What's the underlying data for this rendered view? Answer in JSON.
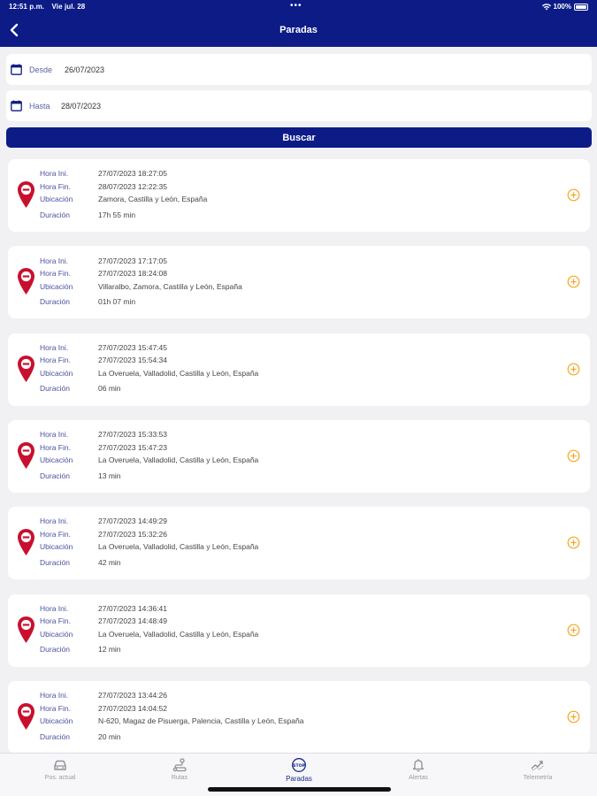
{
  "status_bar": {
    "time": "12:51 p.m.",
    "date": "Vie jul. 28",
    "battery": "100%"
  },
  "header": {
    "title": "Paradas"
  },
  "filters": {
    "desde": {
      "label": "Desde",
      "value": "26/07/2023"
    },
    "hasta": {
      "label": "Hasta",
      "value": "28/07/2023"
    },
    "search_label": "Buscar"
  },
  "labels": {
    "start": "Hora Ini.",
    "end": "Hora Fin.",
    "location": "Ubicación",
    "duration": "Duración"
  },
  "stops": [
    {
      "start": "27/07/2023 18:27:05",
      "end": "28/07/2023 12:22:35",
      "location": "Zamora, Castilla y León, España",
      "duration": "17h 55 min"
    },
    {
      "start": "27/07/2023 17:17:05",
      "end": "27/07/2023 18:24:08",
      "location": "Villaralbo, Zamora, Castilla y León, España",
      "duration": "01h 07 min"
    },
    {
      "start": "27/07/2023 15:47:45",
      "end": "27/07/2023 15:54:34",
      "location": "La Overuela, Valladolid, Castilla y León, España",
      "duration": "06 min"
    },
    {
      "start": "27/07/2023 15:33:53",
      "end": "27/07/2023 15:47:23",
      "location": "La Overuela, Valladolid, Castilla y León, España",
      "duration": "13 min"
    },
    {
      "start": "27/07/2023 14:49:29",
      "end": "27/07/2023 15:32:26",
      "location": "La Overuela, Valladolid, Castilla y León, España",
      "duration": "42 min"
    },
    {
      "start": "27/07/2023 14:36:41",
      "end": "27/07/2023 14:48:49",
      "location": "La Overuela, Valladolid, Castilla y León, España",
      "duration": "12 min"
    },
    {
      "start": "27/07/2023 13:44:26",
      "end": "27/07/2023 14:04:52",
      "location": "N-620, Magaz de Pisuerga, Palencia, Castilla y León, España",
      "duration": "20 min"
    }
  ],
  "tabs": [
    {
      "label": "Pos. actual",
      "icon": "car-icon"
    },
    {
      "label": "Rutas",
      "icon": "route-icon"
    },
    {
      "label": "Paradas",
      "icon": "stop-icon",
      "active": true
    },
    {
      "label": "Alertas",
      "icon": "bell-icon"
    },
    {
      "label": "Telemetría",
      "icon": "telemetry-icon"
    }
  ],
  "colors": {
    "primary": "#0c1b86",
    "pin": "#c8102e",
    "accent": "#f5a623"
  }
}
